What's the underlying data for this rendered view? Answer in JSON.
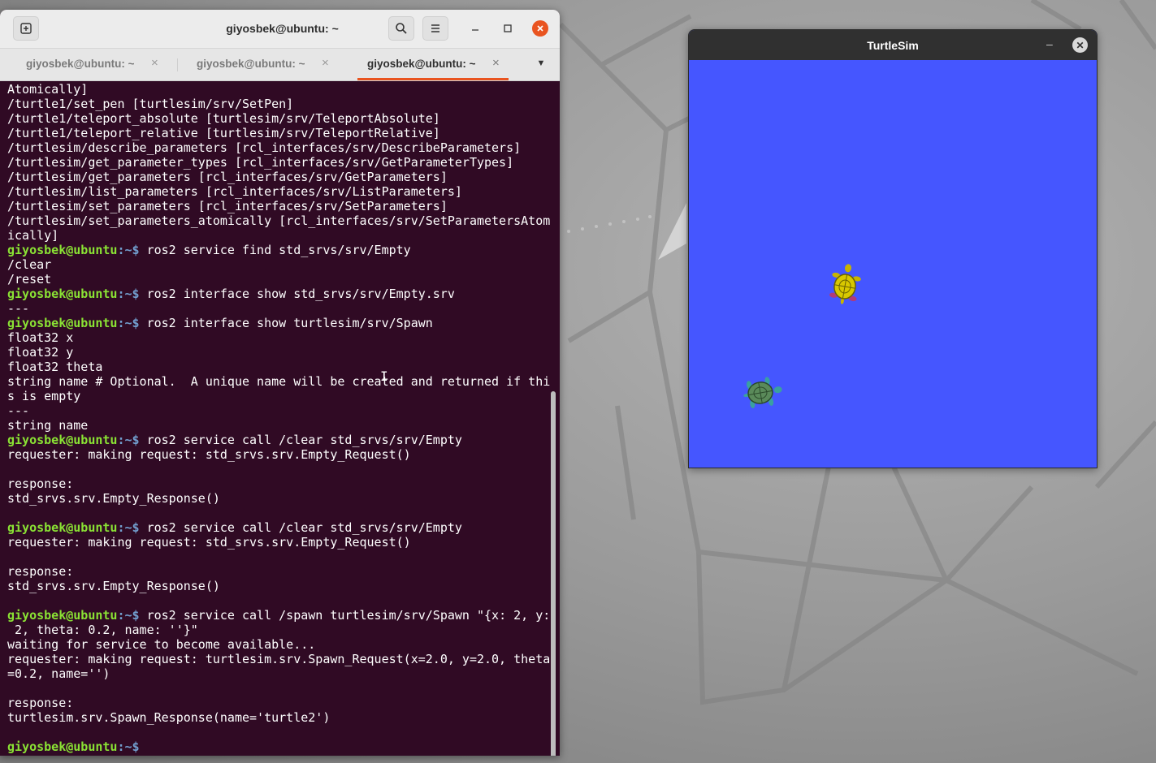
{
  "terminal": {
    "title": "giyosbek@ubuntu: ~",
    "tabs": [
      {
        "label": "giyosbek@ubuntu: ~",
        "active": false
      },
      {
        "label": "giyosbek@ubuntu: ~",
        "active": false
      },
      {
        "label": "giyosbek@ubuntu: ~",
        "active": true
      }
    ],
    "prompt_user": "giyosbek@ubuntu",
    "prompt_path": ":~$",
    "lines": [
      {
        "t": "out",
        "text": "Atomically]"
      },
      {
        "t": "out",
        "text": "/turtle1/set_pen [turtlesim/srv/SetPen]"
      },
      {
        "t": "out",
        "text": "/turtle1/teleport_absolute [turtlesim/srv/TeleportAbsolute]"
      },
      {
        "t": "out",
        "text": "/turtle1/teleport_relative [turtlesim/srv/TeleportRelative]"
      },
      {
        "t": "out",
        "text": "/turtlesim/describe_parameters [rcl_interfaces/srv/DescribeParameters]"
      },
      {
        "t": "out",
        "text": "/turtlesim/get_parameter_types [rcl_interfaces/srv/GetParameterTypes]"
      },
      {
        "t": "out",
        "text": "/turtlesim/get_parameters [rcl_interfaces/srv/GetParameters]"
      },
      {
        "t": "out",
        "text": "/turtlesim/list_parameters [rcl_interfaces/srv/ListParameters]"
      },
      {
        "t": "out",
        "text": "/turtlesim/set_parameters [rcl_interfaces/srv/SetParameters]"
      },
      {
        "t": "out",
        "text": "/turtlesim/set_parameters_atomically [rcl_interfaces/srv/SetParametersAtom"
      },
      {
        "t": "out",
        "text": "ically]"
      },
      {
        "t": "cmd",
        "text": " ros2 service find std_srvs/srv/Empty"
      },
      {
        "t": "out",
        "text": "/clear"
      },
      {
        "t": "out",
        "text": "/reset"
      },
      {
        "t": "cmd",
        "text": " ros2 interface show std_srvs/srv/Empty.srv"
      },
      {
        "t": "out",
        "text": "---"
      },
      {
        "t": "cmd",
        "text": " ros2 interface show turtlesim/srv/Spawn"
      },
      {
        "t": "out",
        "text": "float32 x"
      },
      {
        "t": "out",
        "text": "float32 y"
      },
      {
        "t": "out",
        "text": "float32 theta"
      },
      {
        "t": "out",
        "text": "string name # Optional.  A unique name will be created and returned if thi"
      },
      {
        "t": "out",
        "text": "s is empty"
      },
      {
        "t": "out",
        "text": "---"
      },
      {
        "t": "out",
        "text": "string name"
      },
      {
        "t": "cmd",
        "text": " ros2 service call /clear std_srvs/srv/Empty"
      },
      {
        "t": "out",
        "text": "requester: making request: std_srvs.srv.Empty_Request()"
      },
      {
        "t": "out",
        "text": ""
      },
      {
        "t": "out",
        "text": "response:"
      },
      {
        "t": "out",
        "text": "std_srvs.srv.Empty_Response()"
      },
      {
        "t": "out",
        "text": ""
      },
      {
        "t": "cmd",
        "text": " ros2 service call /clear std_srvs/srv/Empty"
      },
      {
        "t": "out",
        "text": "requester: making request: std_srvs.srv.Empty_Request()"
      },
      {
        "t": "out",
        "text": ""
      },
      {
        "t": "out",
        "text": "response:"
      },
      {
        "t": "out",
        "text": "std_srvs.srv.Empty_Response()"
      },
      {
        "t": "out",
        "text": ""
      },
      {
        "t": "cmd",
        "text": " ros2 service call /spawn turtlesim/srv/Spawn \"{x: 2, y:"
      },
      {
        "t": "out",
        "text": " 2, theta: 0.2, name: ''}\""
      },
      {
        "t": "out",
        "text": "waiting for service to become available..."
      },
      {
        "t": "out",
        "text": "requester: making request: turtlesim.srv.Spawn_Request(x=2.0, y=2.0, theta"
      },
      {
        "t": "out",
        "text": "=0.2, name='')"
      },
      {
        "t": "out",
        "text": ""
      },
      {
        "t": "out",
        "text": "response:"
      },
      {
        "t": "out",
        "text": "turtlesim.srv.Spawn_Response(name='turtle2')"
      },
      {
        "t": "out",
        "text": ""
      },
      {
        "t": "cmd",
        "text": " "
      }
    ]
  },
  "turtlesim": {
    "title": "TurtleSim",
    "background_color": "#4556ff"
  },
  "colors": {
    "terminal_bg": "#300a24",
    "prompt_user": "#8ae234",
    "prompt_path": "#729fcf",
    "tab_accent": "#e95420"
  },
  "icons": {
    "new_tab": "new-tab-icon",
    "search": "search-icon",
    "menu": "hamburger-menu-icon",
    "minimize": "minimize-icon",
    "maximize": "maximize-icon",
    "close": "close-icon",
    "tab_menu": "chevron-down-icon"
  }
}
